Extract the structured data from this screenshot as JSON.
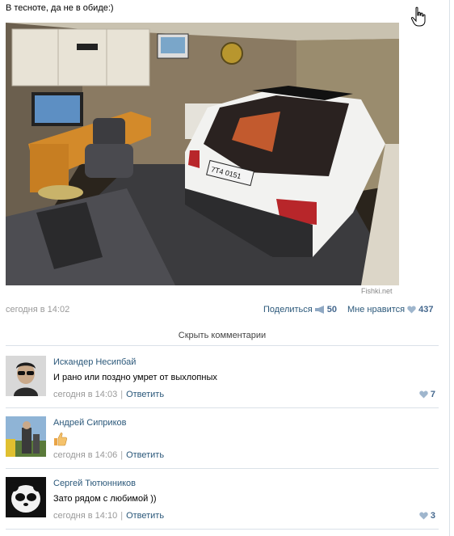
{
  "post": {
    "text": "В тесноте, да не в обиде:)",
    "watermark": "Fishki.net",
    "date": "сегодня в 14:02",
    "share_label": "Поделиться",
    "share_count": "50",
    "like_label": "Мне нравится",
    "like_count": "437",
    "hide_comments_label": "Скрыть комментарии",
    "license_plate": "7T4 0151"
  },
  "comments": [
    {
      "author": "Искандер Несипбай",
      "text": "И рано или поздно умрет от выхлопных",
      "date": "сегодня в 14:03",
      "reply_label": "Ответить",
      "likes": "7"
    },
    {
      "author": "Андрей Сиприков",
      "text": "",
      "emoji": "thumbs-up-emoji",
      "date": "сегодня в 14:06",
      "reply_label": "Ответить",
      "likes": ""
    },
    {
      "author": "Сергей Тютюнников",
      "text": "Зато рядом с любимой ))",
      "date": "сегодня в 14:10",
      "reply_label": "Ответить",
      "likes": "3"
    }
  ],
  "colors": {
    "link": "#2b587a",
    "muted": "#999999",
    "divider": "#dae1e8",
    "like_blue": "#45688e"
  }
}
